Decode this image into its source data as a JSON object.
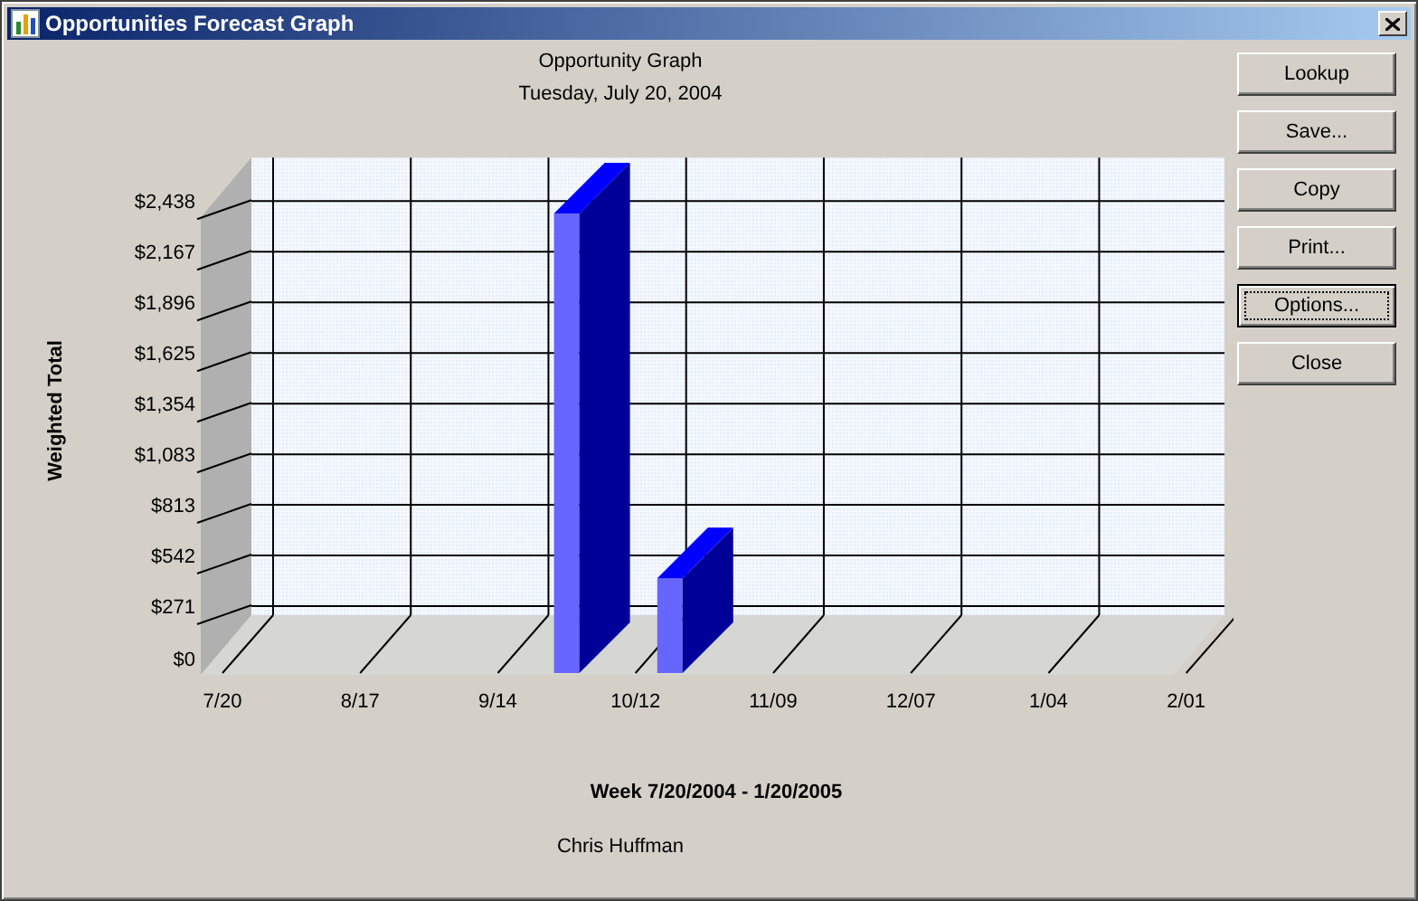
{
  "window": {
    "title": "Opportunities Forecast Graph"
  },
  "graph": {
    "title": "Opportunity Graph",
    "subtitle": "Tuesday, July 20, 2004",
    "footer": "Chris Huffman",
    "chart_data": {
      "type": "bar",
      "ylabel": "Weighted Total",
      "xlabel": "Week 7/20/2004 - 1/20/2005",
      "categories": [
        "7/20",
        null,
        null,
        null,
        "8/17",
        null,
        null,
        null,
        "9/14",
        null,
        null,
        null,
        "10/12",
        null,
        null,
        null,
        "11/09",
        null,
        null,
        null,
        "12/07",
        null,
        null,
        null,
        "1/04",
        null,
        null,
        null,
        "2/01"
      ],
      "grid": true,
      "series": [
        {
          "color": "#6666ff",
          "values": [
            null,
            null,
            null,
            null,
            null,
            null,
            null,
            null,
            null,
            null,
            2370,
            null,
            null,
            420,
            null,
            null,
            null,
            null,
            null,
            null,
            null,
            null,
            null,
            null,
            null,
            null,
            null,
            null,
            null
          ]
        }
      ],
      "ylim": [
        0,
        2438
      ],
      "yticks": [
        {
          "value": 0,
          "label": "$0"
        },
        {
          "value": 271,
          "label": "$271"
        },
        {
          "value": 542,
          "label": "$542"
        },
        {
          "value": 813,
          "label": "$813"
        },
        {
          "value": 1083,
          "label": "$1,083"
        },
        {
          "value": 1354,
          "label": "$1,354"
        },
        {
          "value": 1625,
          "label": "$1,625"
        },
        {
          "value": 1896,
          "label": "$1,896"
        },
        {
          "value": 2167,
          "label": "$2,167"
        },
        {
          "value": 2438,
          "label": "$2,438"
        }
      ]
    }
  },
  "buttons": [
    {
      "label": "Lookup",
      "focused": false
    },
    {
      "label": "Save...",
      "focused": false
    },
    {
      "label": "Copy",
      "focused": false
    },
    {
      "label": "Print...",
      "focused": false
    },
    {
      "label": "Options...",
      "focused": true
    },
    {
      "label": "Close",
      "focused": false
    }
  ]
}
